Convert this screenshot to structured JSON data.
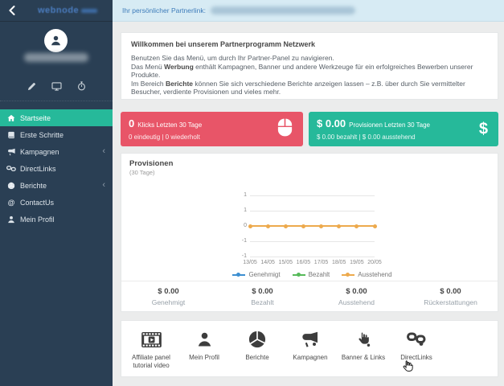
{
  "topbar": {
    "partner_link_label": "Ihr persönlicher Partnerlink:"
  },
  "sidebar": {
    "logo": "webnode",
    "profile_icons": [
      "pencil-icon",
      "monitor-icon",
      "stopwatch-icon"
    ],
    "menu": [
      {
        "label": "Startseite",
        "icon": "home-icon",
        "active": true,
        "chevron": false
      },
      {
        "label": "Erste Schritte",
        "icon": "book-icon",
        "active": false,
        "chevron": false
      },
      {
        "label": "Kampagnen",
        "icon": "bullhorn-icon",
        "active": false,
        "chevron": true
      },
      {
        "label": "DirectLinks",
        "icon": "links-icon",
        "active": false,
        "chevron": false
      },
      {
        "label": "Berichte",
        "icon": "pie-chart-icon",
        "active": false,
        "chevron": true
      },
      {
        "label": "ContactUs",
        "icon": "at-icon",
        "active": false,
        "chevron": false
      },
      {
        "label": "Mein Profil",
        "icon": "user-icon",
        "active": false,
        "chevron": false
      }
    ]
  },
  "welcome": {
    "title": "Willkommen bei unserem Partnerprogramm Netzwerk",
    "line1": "Benutzen Sie das Menü, um durch Ihr Partner-Panel zu navigieren.",
    "line2_pre": "Das Menü ",
    "line2_bold": "Werbung",
    "line2_post": " enthält Kampagnen, Banner und andere Werkzeuge für ein erfolgreiches Bewerben unserer Produkte.",
    "line3_pre": "Im Bereich ",
    "line3_bold": "Berichte",
    "line3_post": " können Sie sich verschiedene Berichte anzeigen lassen – z.B. über durch Sie vermittelter Besucher, verdiente Provisionen und vieles mehr."
  },
  "stat_cards": {
    "clicks": {
      "value": "0",
      "label": "Klicks Letzten 30 Tage",
      "sub": "0 eindeutig | 0 wiederholt",
      "color": "#e85568",
      "icon": "mouse-icon"
    },
    "commissions": {
      "value": "$ 0.00",
      "label": "Provisionen Letzten 30 Tage",
      "sub": "$ 0.00 bezahlt | $ 0.00 ausstehend",
      "color": "#26b99a",
      "icon": "dollar-icon"
    }
  },
  "chart_data": {
    "type": "line",
    "title": "Provisionen",
    "subtitle": "(30 Tage)",
    "x": [
      "13/05",
      "14/05",
      "15/05",
      "16/05",
      "17/05",
      "18/05",
      "19/05",
      "20/05"
    ],
    "series": [
      {
        "name": "Genehmigt",
        "color": "#3d8fd1",
        "values": [
          0,
          0,
          0,
          0,
          0,
          0,
          0,
          0
        ]
      },
      {
        "name": "Bezahlt",
        "color": "#56ba5a",
        "values": [
          0,
          0,
          0,
          0,
          0,
          0,
          0,
          0
        ]
      },
      {
        "name": "Ausstehend",
        "color": "#edaa4d",
        "values": [
          0,
          0,
          0,
          0,
          0,
          0,
          0,
          0
        ]
      }
    ],
    "ylim": [
      -1,
      1
    ],
    "ytick_labels": [
      "1",
      "1",
      "0",
      "-1",
      "-1"
    ],
    "grid": true,
    "legend_position": "bottom"
  },
  "summary": [
    {
      "value": "$ 0.00",
      "label": "Genehmigt"
    },
    {
      "value": "$ 0.00",
      "label": "Bezahlt"
    },
    {
      "value": "$ 0.00",
      "label": "Ausstehend"
    },
    {
      "value": "$ 0.00",
      "label": "Rückerstattungen"
    }
  ],
  "shortcuts": [
    {
      "label": "Affiliate panel tutorial video",
      "icon": "film-icon"
    },
    {
      "label": "Mein Profil",
      "icon": "user-icon"
    },
    {
      "label": "Berichte",
      "icon": "pie-chart-icon"
    },
    {
      "label": "Kampagnen",
      "icon": "bullhorn-icon"
    },
    {
      "label": "Banner & Links",
      "icon": "hand-pointer-icon"
    },
    {
      "label": "DirectLinks",
      "icon": "links-icon"
    }
  ],
  "colors": {
    "sidebar": "#2a3f54",
    "active_menu": "#26b99a",
    "topbar_bg": "#d7ebf4",
    "clicks_card": "#e85568",
    "commissions_card": "#26b99a",
    "line_color": "#edaa4d"
  }
}
